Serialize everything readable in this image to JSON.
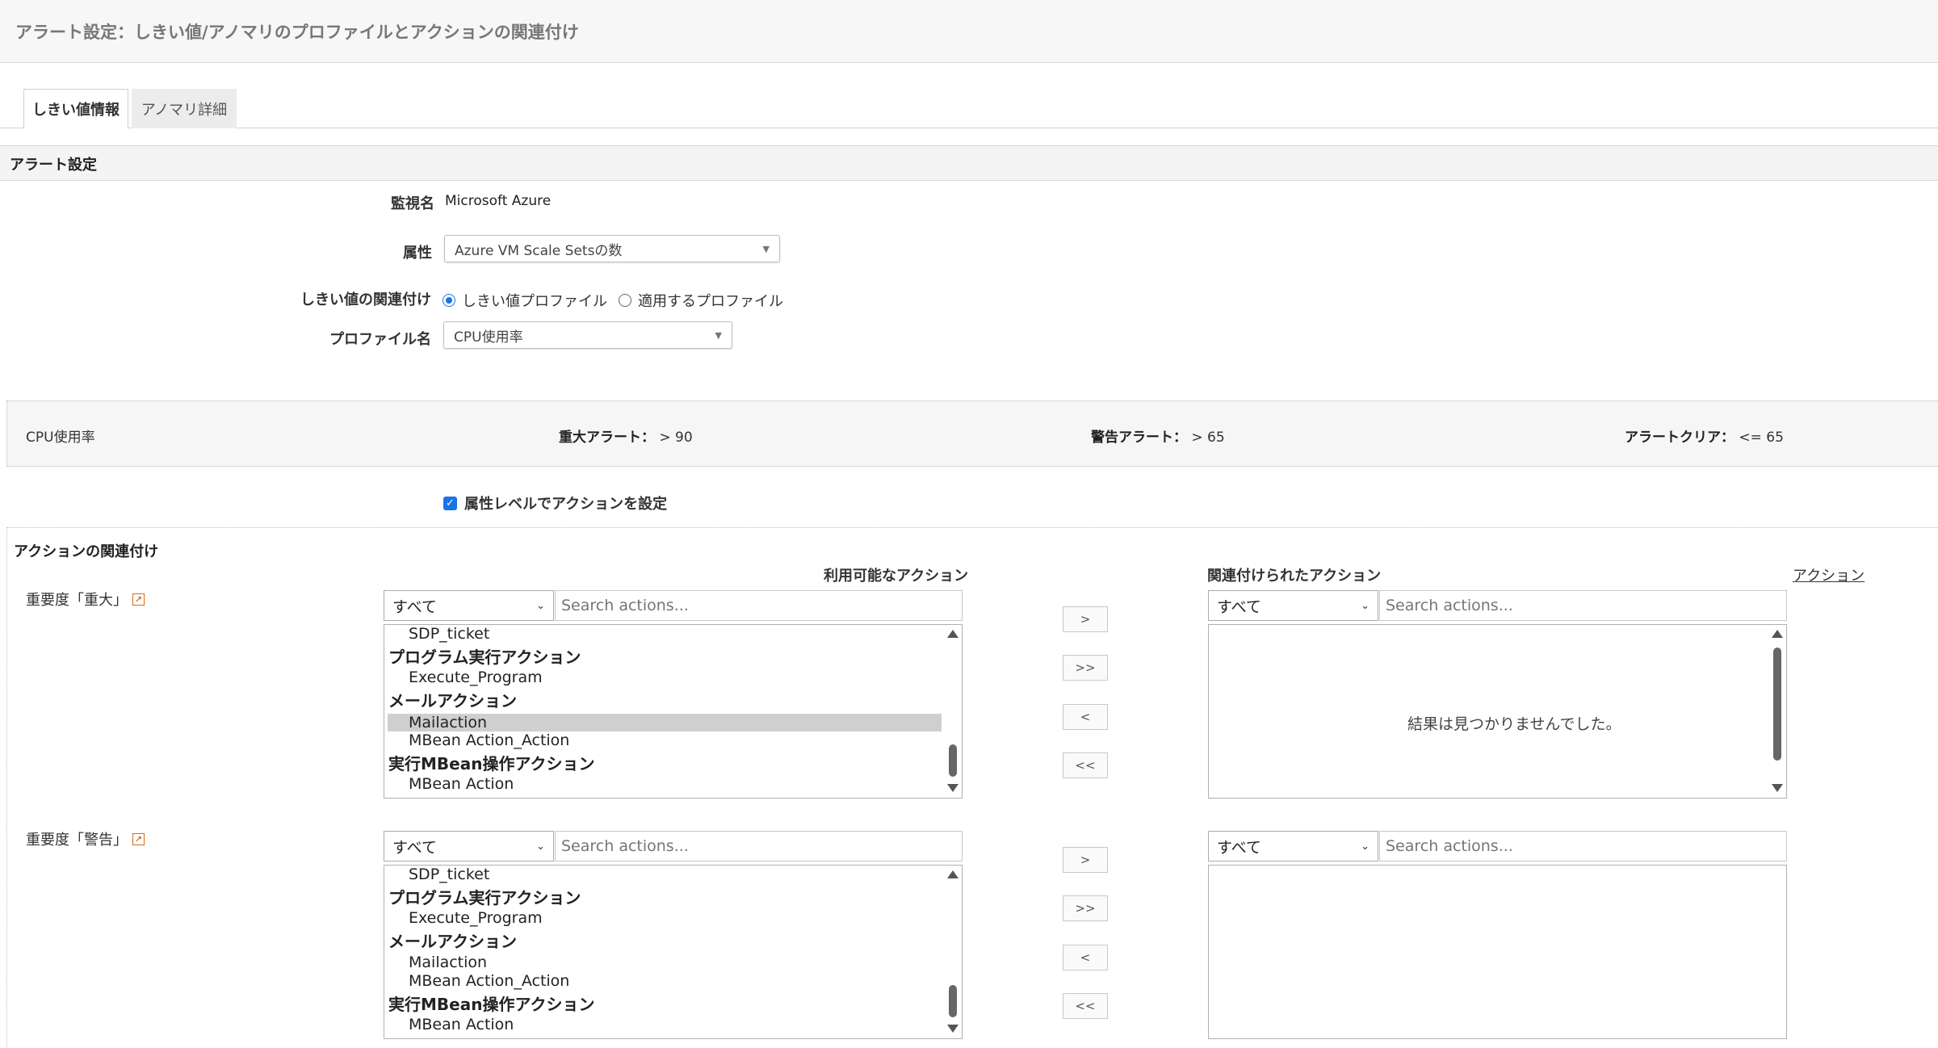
{
  "header": {
    "title": "アラート設定：しきい値/アノマリのプロファイルとアクションの関連付け"
  },
  "tabs": [
    {
      "label": "しきい値情報",
      "active": true
    },
    {
      "label": "アノマリ詳細",
      "active": false
    }
  ],
  "alert_settings": {
    "section_title": "アラート設定",
    "monitor_name_label": "監視名",
    "monitor_name_value": "Microsoft Azure",
    "attribute_label": "属性",
    "attribute_value": "Azure VM Scale Setsの数",
    "threshold_assoc_label": "しきい値の関連付け",
    "radio_threshold_profile": "しきい値プロファイル",
    "radio_applied_profile": "適用するプロファイル",
    "selected_radio": "radio_threshold_profile",
    "profile_name_label": "プロファイル名",
    "profile_name_value": "CPU使用率"
  },
  "profile_summary": {
    "name": "CPU使用率",
    "critical_label": "重大アラート：",
    "critical_value": "> 90",
    "warning_label": "警告アラート：",
    "warning_value": "> 65",
    "clear_label": "アラートクリア：",
    "clear_value": "<= 65"
  },
  "attribute_level_checkbox": {
    "label": "属性レベルでアクションを設定",
    "checked": true
  },
  "action_assoc": {
    "title": "アクションの関連付け",
    "available_header": "利用可能なアクション",
    "associated_header": "関連付けられたアクション",
    "actions_link": "アクション",
    "empty_message": "結果は見つかりませんでした。",
    "filter_value": "すべて",
    "search_placeholder": "Search actions...",
    "buttons": {
      "add": ">",
      "add_all": ">>",
      "remove": "<",
      "remove_all": "<<"
    },
    "severities": [
      {
        "label": "重要度「重大」",
        "available_items": [
          {
            "text": "SDP_ticket",
            "type": "item"
          },
          {
            "text": "プログラム実行アクション",
            "type": "group"
          },
          {
            "text": "Execute_Program",
            "type": "item"
          },
          {
            "text": "メールアクション",
            "type": "group"
          },
          {
            "text": "Mailaction",
            "type": "item",
            "selected": true
          },
          {
            "text": "MBean Action_Action",
            "type": "item"
          },
          {
            "text": "実行MBean操作アクション",
            "type": "group"
          },
          {
            "text": "MBean Action",
            "type": "item"
          }
        ]
      },
      {
        "label": "重要度「警告」",
        "available_items": [
          {
            "text": "SDP_ticket",
            "type": "item"
          },
          {
            "text": "プログラム実行アクション",
            "type": "group"
          },
          {
            "text": "Execute_Program",
            "type": "item"
          },
          {
            "text": "メールアクション",
            "type": "group"
          },
          {
            "text": "Mailaction",
            "type": "item"
          },
          {
            "text": "MBean Action_Action",
            "type": "item"
          },
          {
            "text": "実行MBean操作アクション",
            "type": "group"
          },
          {
            "text": "MBean Action",
            "type": "item"
          }
        ]
      }
    ]
  },
  "colors": {
    "accent": "#1a73e8",
    "external_icon": "#d4691e",
    "selected_row": "#cfcfcf"
  }
}
